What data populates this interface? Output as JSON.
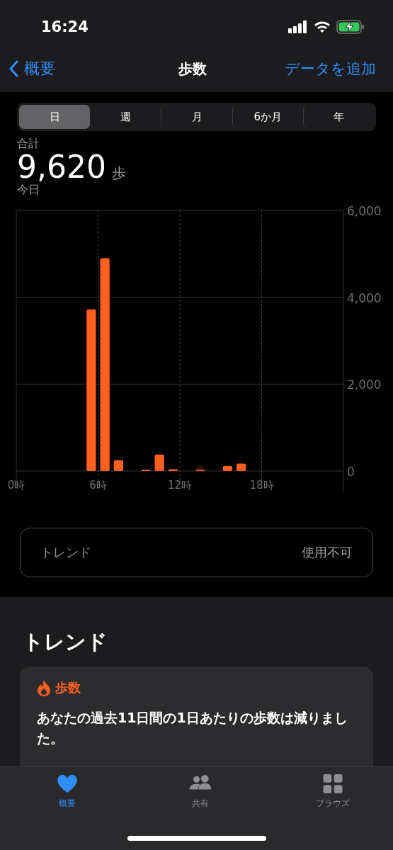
{
  "status_bar": {
    "time": "16:24"
  },
  "nav": {
    "back": "概要",
    "title": "歩数",
    "action": "データを追加"
  },
  "segments": [
    {
      "label": "日",
      "selected": true
    },
    {
      "label": "週",
      "selected": false
    },
    {
      "label": "月",
      "selected": false
    },
    {
      "label": "6か月",
      "selected": false
    },
    {
      "label": "年",
      "selected": false
    }
  ],
  "summary": {
    "label": "合計",
    "value": "9,620",
    "unit": "歩",
    "period": "今日"
  },
  "chart_data": {
    "type": "bar",
    "x": [
      0.5,
      1.5,
      2.5,
      3.5,
      4.5,
      5.5,
      6.5,
      7.5,
      8.5,
      9.5,
      10.5,
      11.5,
      12.5,
      13.5,
      14.5,
      15.5,
      16.5,
      17.5,
      18.5,
      19.5,
      20.5,
      21.5,
      22.5,
      23.5
    ],
    "series": [
      {
        "color": "#ff5f1f",
        "values": [
          0,
          0,
          0,
          0,
          0,
          3720,
          4900,
          250,
          0,
          30,
          380,
          40,
          0,
          10,
          0,
          120,
          170,
          0,
          0,
          0,
          0,
          0,
          0,
          0
        ]
      }
    ],
    "xlim": [
      0,
      24
    ],
    "grid": true,
    "ylim": [
      0,
      6000
    ],
    "xticks": [
      {
        "value": 0,
        "label": "0時"
      },
      {
        "value": 6,
        "label": "6時"
      },
      {
        "value": 12,
        "label": "12時"
      },
      {
        "value": 18,
        "label": "18時"
      }
    ],
    "yticks": [
      {
        "value": 0,
        "label": "0"
      },
      {
        "value": 2000,
        "label": "2,000"
      },
      {
        "value": 4000,
        "label": "4,000"
      },
      {
        "value": 6000,
        "label": "6,000"
      }
    ]
  },
  "trend_row": {
    "label": "トレンド",
    "value": "使用不可"
  },
  "trends": {
    "heading": "トレンド",
    "card": {
      "category": "歩数",
      "text": "あなたの過去11日間の1日あたりの歩数は減りました。"
    }
  },
  "tab_bar": [
    {
      "label": "概要",
      "kind": "heart",
      "selected": true
    },
    {
      "label": "共有",
      "kind": "people",
      "selected": false
    },
    {
      "label": "ブラウズ",
      "kind": "grid",
      "selected": false
    }
  ]
}
